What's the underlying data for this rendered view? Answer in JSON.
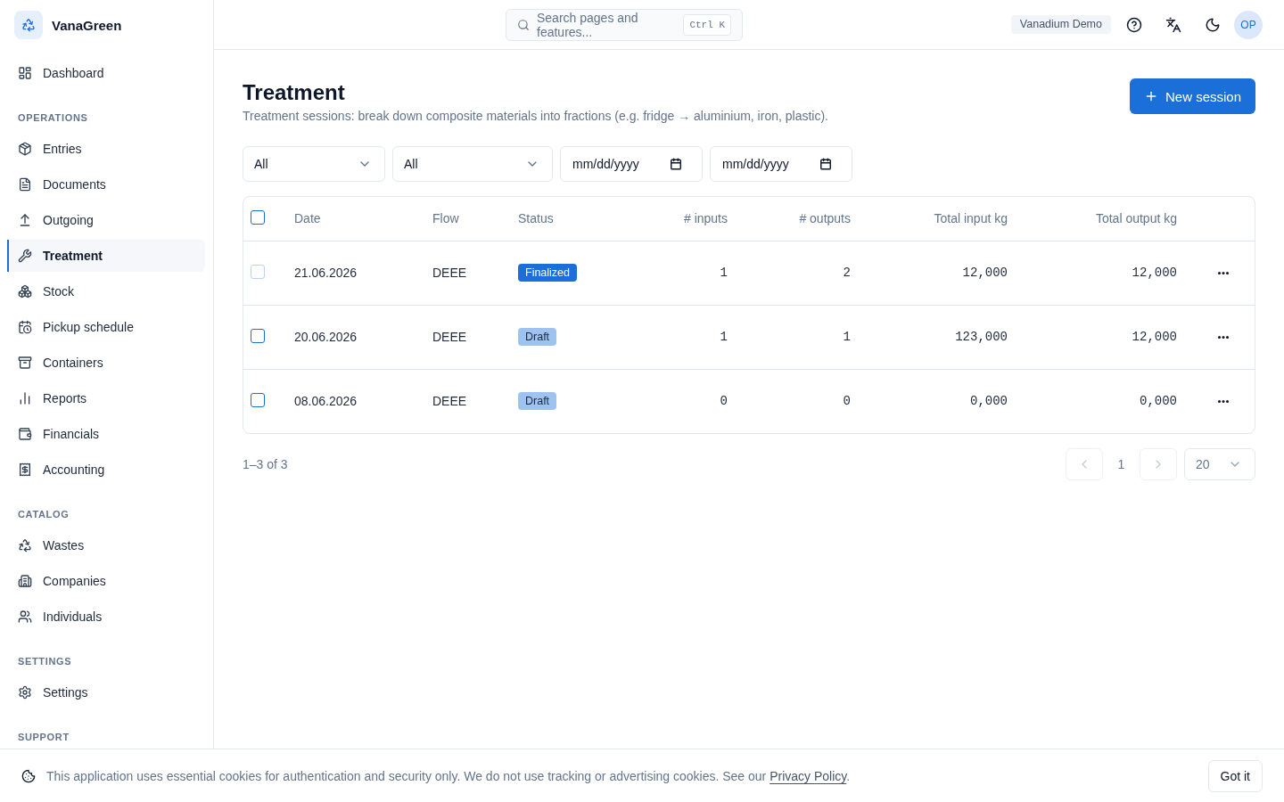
{
  "sidebar": {
    "brand": "VanaGreen",
    "sections": [
      {
        "items": [
          {
            "label": "Dashboard",
            "selected": false
          }
        ]
      },
      {
        "title": "OPERATIONS",
        "items": [
          {
            "label": "Entries",
            "selected": false
          },
          {
            "label": "Documents",
            "selected": false
          },
          {
            "label": "Outgoing",
            "selected": false
          },
          {
            "label": "Treatment",
            "selected": true
          },
          {
            "label": "Stock",
            "selected": false
          },
          {
            "label": "Pickup schedule",
            "selected": false
          },
          {
            "label": "Containers",
            "selected": false
          },
          {
            "label": "Reports",
            "selected": false
          },
          {
            "label": "Financials",
            "selected": false
          },
          {
            "label": "Accounting",
            "selected": false
          }
        ]
      },
      {
        "title": "CATALOG",
        "items": [
          {
            "label": "Wastes",
            "selected": false
          },
          {
            "label": "Companies",
            "selected": false
          },
          {
            "label": "Individuals",
            "selected": false
          }
        ]
      },
      {
        "title": "SETTINGS",
        "items": [
          {
            "label": "Settings",
            "selected": false
          }
        ]
      },
      {
        "title": "SUPPORT"
      }
    ]
  },
  "header": {
    "search": {
      "placeholder": "Search pages and features...",
      "shortcut": "Ctrl K"
    },
    "workspace": "Vanadium Demo",
    "avatar": "OP"
  },
  "page": {
    "title": "Treatment",
    "subtitle": "Treatment sessions: break down composite materials into fractions (e.g. fridge → aluminium, iron, plastic).",
    "primary_action": "New session"
  },
  "filters": [
    {
      "kind": "select",
      "value": "All"
    },
    {
      "kind": "select",
      "value": "All"
    },
    {
      "kind": "date",
      "placeholder": "mm/dd/yyyy"
    },
    {
      "kind": "date",
      "placeholder": "mm/dd/yyyy"
    }
  ],
  "table": {
    "select_all": {
      "checked": false
    },
    "columns": [
      "Date",
      "Flow",
      "Status",
      "# inputs",
      "# outputs",
      "Total input kg",
      "Total output kg"
    ],
    "rows": [
      {
        "checked": false,
        "select_disabled": true,
        "date": "21.06.2026",
        "flow": "DEEE",
        "status": {
          "label": "Finalized",
          "kind": "finalized"
        },
        "inputs": "1",
        "outputs": "2",
        "total_input_kg": "12,000",
        "total_output_kg": "12,000"
      },
      {
        "checked": false,
        "select_disabled": false,
        "date": "20.06.2026",
        "flow": "DEEE",
        "status": {
          "label": "Draft",
          "kind": "draft"
        },
        "inputs": "1",
        "outputs": "1",
        "total_input_kg": "123,000",
        "total_output_kg": "12,000"
      },
      {
        "checked": false,
        "select_disabled": false,
        "date": "08.06.2026",
        "flow": "DEEE",
        "status": {
          "label": "Draft",
          "kind": "draft"
        },
        "inputs": "0",
        "outputs": "0",
        "total_input_kg": "0,000",
        "total_output_kg": "0,000"
      }
    ]
  },
  "pagination": {
    "summary": "1–3 of 3",
    "previous": {
      "disabled": true
    },
    "page": "1",
    "next": {
      "disabled": true
    },
    "page_size": "20"
  },
  "cookie_notice": {
    "text": "This application uses essential cookies for authentication and security only. We do not use tracking or advertising cookies. See our",
    "link": "Privacy Policy",
    "after": ".",
    "button": "Got it"
  }
}
